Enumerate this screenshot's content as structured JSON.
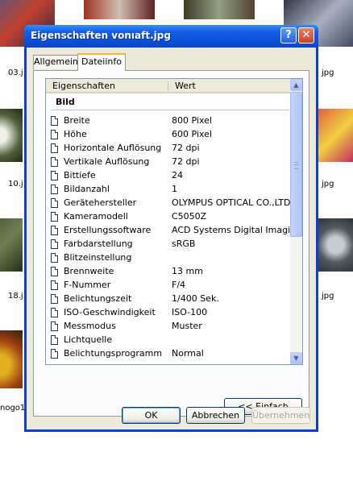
{
  "background": {
    "labels": [
      "03.j",
      "jpg",
      "10.j",
      "jpg",
      "18.j",
      "jpg",
      "nogo1"
    ]
  },
  "window": {
    "title": "Eigenschaften vonıaft.jpg",
    "help_icon": "question-icon",
    "close_icon": "close-icon"
  },
  "tabs": [
    {
      "label": "Allgemein",
      "active": false
    },
    {
      "label": "Dateiinfo",
      "active": true
    }
  ],
  "listview": {
    "columns": [
      "Eigenschaften",
      "Wert"
    ],
    "group": "Bild",
    "rows": [
      {
        "prop": "Breite",
        "val": "800 Pixel"
      },
      {
        "prop": "Höhe",
        "val": "600 Pixel"
      },
      {
        "prop": "Horizontale Auflösung",
        "val": "72 dpi"
      },
      {
        "prop": "Vertikale Auflösung",
        "val": "72 dpi"
      },
      {
        "prop": "Bittiefe",
        "val": "24"
      },
      {
        "prop": "Bildanzahl",
        "val": "1"
      },
      {
        "prop": "Gerätehersteller",
        "val": "OLYMPUS OPTICAL CO.,LTD"
      },
      {
        "prop": "Kameramodell",
        "val": "C5050Z"
      },
      {
        "prop": "Erstellungssoftware",
        "val": "ACD Systems Digital Imaging"
      },
      {
        "prop": "Farbdarstellung",
        "val": "sRGB"
      },
      {
        "prop": "Blitzeinstellung",
        "val": ""
      },
      {
        "prop": "Brennweite",
        "val": "13 mm"
      },
      {
        "prop": "F-Nummer",
        "val": "F/4"
      },
      {
        "prop": "Belichtungszeit",
        "val": "1/400 Sek."
      },
      {
        "prop": "ISO-Geschwindigkeit",
        "val": "ISO-100"
      },
      {
        "prop": "Messmodus",
        "val": "Muster"
      },
      {
        "prop": "Lichtquelle",
        "val": ""
      },
      {
        "prop": "Belichtungsprogramm",
        "val": "Normal"
      }
    ]
  },
  "buttons": {
    "einfach": "<< Einfach",
    "ok": "OK",
    "abbrechen": "Abbrechen",
    "apply": "Übernehmen"
  },
  "colors": {
    "titlebar": "#0a46c4",
    "dialog_face": "#ece9d8",
    "active_tab_accent": "#f9b53a"
  }
}
